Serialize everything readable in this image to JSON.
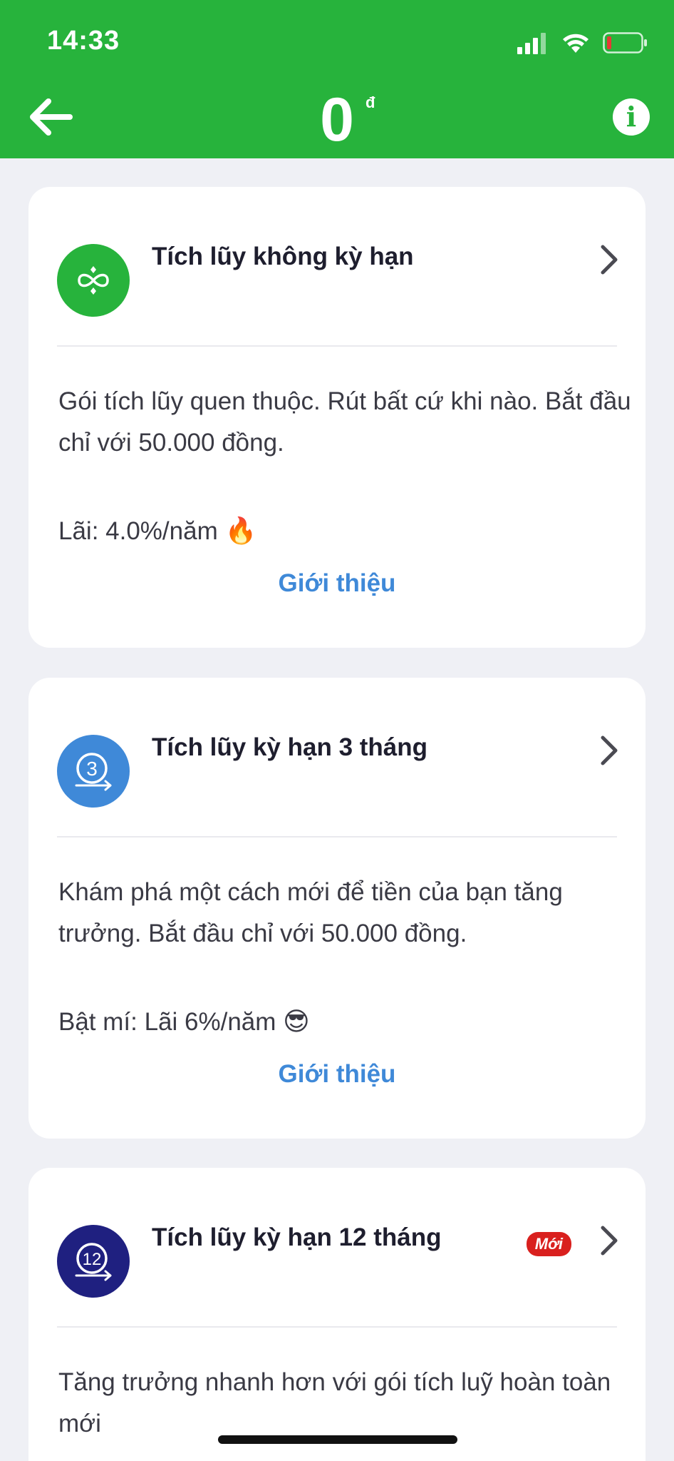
{
  "status": {
    "time": "14:33"
  },
  "header": {
    "balance": "0",
    "currency": "đ"
  },
  "cards": [
    {
      "title": "Tích lũy không kỳ hạn",
      "icon": "infinity-icon",
      "icon_color": "#27b33c",
      "description": "Gói tích lũy quen thuộc. Rút bất cứ khi nào. Bắt đầu chỉ với 50.000 đồng.",
      "rate": "Lãi: 4.0%/năm",
      "emoji": "🔥",
      "link": "Giới thiệu"
    },
    {
      "title": "Tích lũy kỳ hạn 3 tháng",
      "icon": "term-3-icon",
      "icon_label": "3",
      "icon_color": "#3f89d8",
      "description": "Khám phá một cách mới để tiền của bạn tăng trưởng. Bắt đầu chỉ với 50.000 đồng.",
      "rate": "Bật mí: Lãi 6%/năm",
      "emoji": "😎",
      "link": "Giới thiệu"
    },
    {
      "title": "Tích lũy kỳ hạn 12 tháng",
      "icon": "term-12-icon",
      "icon_label": "12",
      "icon_color": "#1f2080",
      "badge": "Mới",
      "description": "Tăng trưởng nhanh hơn với gói tích luỹ hoàn toàn mới"
    }
  ],
  "colors": {
    "brand": "#27b33c",
    "link": "#3f89d8",
    "badge": "#d9201e"
  }
}
